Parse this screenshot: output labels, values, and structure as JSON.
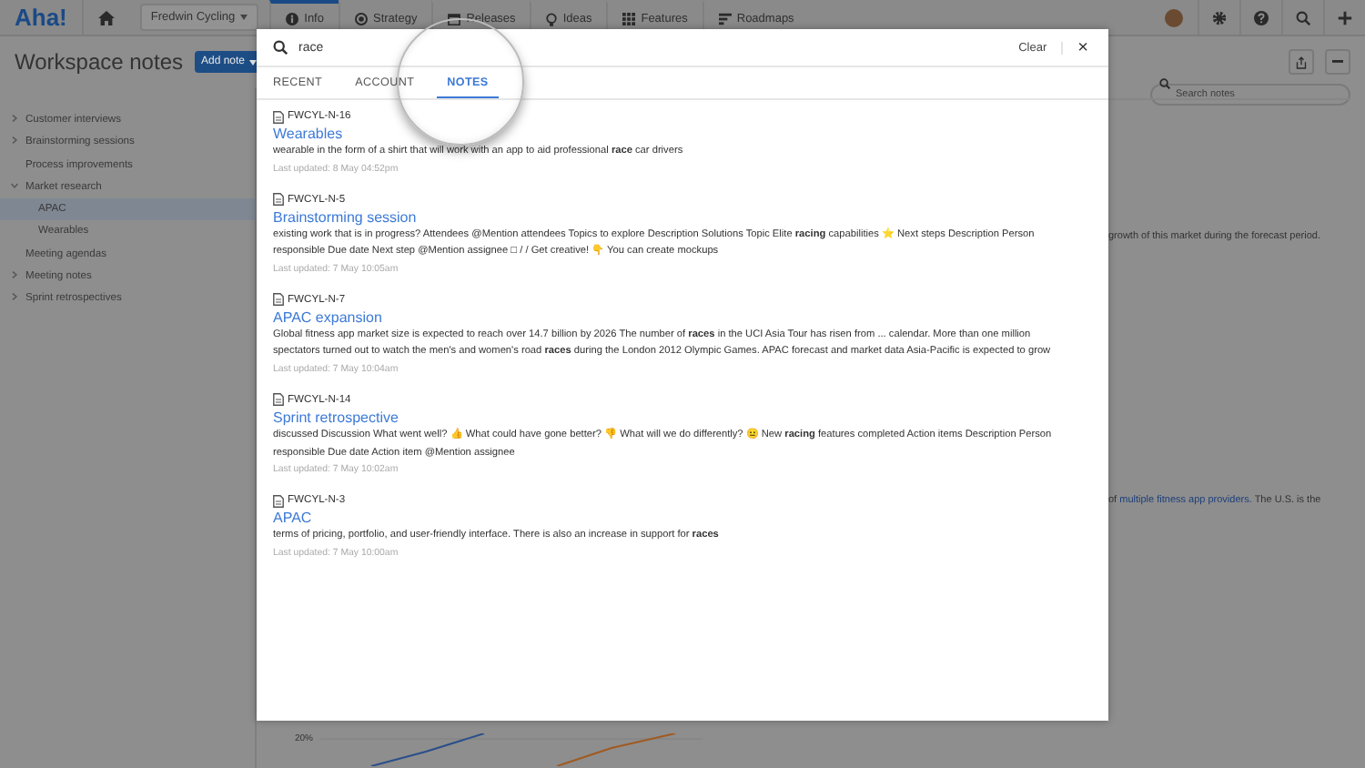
{
  "topbar": {
    "logo": "Aha!",
    "workspace": "Fredwin Cycling",
    "nav": [
      {
        "label": "Info",
        "selected": true
      },
      {
        "label": "Strategy",
        "selected": false
      },
      {
        "label": "Releases",
        "selected": false
      },
      {
        "label": "Ideas",
        "selected": false
      },
      {
        "label": "Features",
        "selected": false
      },
      {
        "label": "Roadmaps",
        "selected": false
      }
    ]
  },
  "page": {
    "title": "Workspace notes",
    "add_button": "Add note",
    "search": {
      "placeholder": "Search notes"
    }
  },
  "sidebar": {
    "items": [
      {
        "label": "Customer interviews",
        "kind": "folder",
        "expanded": false,
        "selected": false
      },
      {
        "label": "Brainstorming sessions",
        "kind": "folder",
        "expanded": false,
        "selected": false
      },
      {
        "label": "Process improvements",
        "kind": "leaf",
        "selected": false
      },
      {
        "label": "Market research",
        "kind": "folder",
        "expanded": true,
        "selected": false,
        "children": [
          {
            "label": "APAC",
            "selected": true
          },
          {
            "label": "Wearables",
            "selected": false
          }
        ]
      },
      {
        "label": "Meeting agendas",
        "kind": "leaf",
        "selected": false
      },
      {
        "label": "Meeting notes",
        "kind": "folder",
        "expanded": false,
        "selected": false
      },
      {
        "label": "Sprint retrospectives",
        "kind": "folder",
        "expanded": false,
        "selected": false
      }
    ]
  },
  "content": {
    "text_1": "growth of this market during the forecast period.",
    "text_2_before": "of",
    "text_2_link": "multiple fitness app providers.",
    "text_2_after": "The U.S. is the",
    "chart_label": "20%"
  },
  "search_modal": {
    "query": "race",
    "clear": "Clear",
    "close": "×",
    "tabs": [
      {
        "label": "RECENT",
        "selected": false
      },
      {
        "label": "ACCOUNT",
        "selected": false
      },
      {
        "label": "NOTES",
        "selected": true
      }
    ],
    "results": [
      {
        "id": "FWCYL-N-16",
        "title": "Wearables",
        "snippet": "wearable in the form of a shirt that will work with an app to aid professional **race** car drivers",
        "updated": "Last updated: 8 May 04:52pm"
      },
      {
        "id": "FWCYL-N-5",
        "title": "Brainstorming session",
        "snippet": "existing work that is in progress? Attendees @Mention attendees Topics to explore Description Solutions Topic Elite **racing** capabilities ⭐  Next steps Description Person responsible Due date Next step @Mention assignee □ / / Get creative! 👇 You can create mockups",
        "updated": "Last updated: 7 May 10:05am"
      },
      {
        "id": "FWCYL-N-7",
        "title": "APAC expansion",
        "snippet": "Global fitness app market size is expected to reach over 14.7 billion by 2026 The number of **races** in the UCI Asia Tour has risen from ... calendar. More than one million spectators turned out to watch the men's and women's road **races** during the London 2012 Olympic Games. APAC forecast and market data Asia-Pacific is expected to grow",
        "updated": "Last updated: 7 May 10:04am"
      },
      {
        "id": "FWCYL-N-14",
        "title": "Sprint retrospective",
        "snippet": "discussed Discussion What went well? 👍  What could have gone better? 👎  What will we do differently? 😐  New **racing** features completed Action items Description Person responsible Due date Action item @Mention assignee",
        "updated": "Last updated: 7 May 10:02am"
      },
      {
        "id": "FWCYL-N-3",
        "title": "APAC",
        "snippet": "terms of pricing, portfolio, and user-friendly interface. There is also an increase in support for **races**",
        "updated": "Last updated: 7 May 10:00am"
      }
    ]
  }
}
